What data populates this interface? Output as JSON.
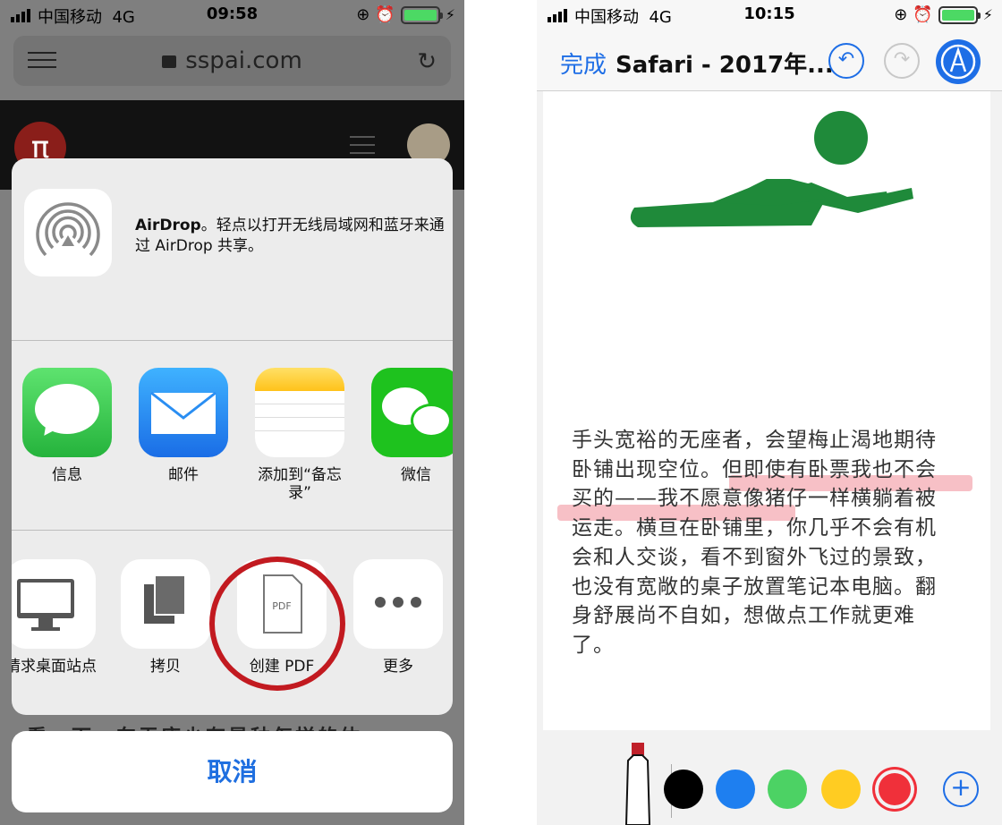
{
  "left_screen": {
    "status": {
      "carrier": "中国移动",
      "network": "4G",
      "time": "09:58"
    },
    "browser": {
      "url": "sspai.com",
      "logo_text": "π"
    },
    "share_sheet": {
      "airdrop_title": "AirDrop",
      "airdrop_desc": "。轻点以打开无线局域网和蓝牙来通过 AirDrop 共享。",
      "apps": [
        {
          "label": "信息",
          "icon": "messages-icon",
          "color": "#3fcb4e"
        },
        {
          "label": "邮件",
          "icon": "mail-icon",
          "color": "#2a8ef2"
        },
        {
          "label": "添加到“备忘录”",
          "icon": "notes-icon",
          "color": "#ffd42a"
        },
        {
          "label": "微信",
          "icon": "wechat-icon",
          "color": "#1ec21e"
        }
      ],
      "actions": [
        {
          "label": "请求桌面站点",
          "icon": "desktop-icon"
        },
        {
          "label": "拷贝",
          "icon": "copy-icon"
        },
        {
          "label": "创建 PDF",
          "icon": "pdf-icon",
          "icon_text": "PDF"
        },
        {
          "label": "更多",
          "icon": "more-icon"
        }
      ],
      "cancel_label": "取消",
      "peek_text": "看一下，车无座少有是种怎样的体"
    }
  },
  "right_screen": {
    "status": {
      "carrier": "中国移动",
      "network": "4G",
      "time": "10:15"
    },
    "header": {
      "done_label": "完成",
      "title": "Safari - 2017年..."
    },
    "document": {
      "lines": [
        "手头宽裕的无座者，会望梅止渴地期待",
        "卧铺出现空位。但即使有卧票我也不会",
        "买的——我不愿意像猪仔一样横躺着被",
        "运走。横亘在卧铺里，你几乎不会有机",
        "会和人交谈，看不到窗外飞过的景致，",
        "也没有宽敞的桌子放置笔记本电脑。翻",
        "身舒展尚不自如，想做点工作就更难",
        "了。"
      ]
    },
    "palette": {
      "colors": [
        "#000000",
        "#1e7ff0",
        "#4cd264",
        "#ffcc22",
        "#f0303a"
      ],
      "selected": "#f0303a",
      "pen_tip": "#c0202a",
      "illustration": "#1f8a3a"
    }
  }
}
